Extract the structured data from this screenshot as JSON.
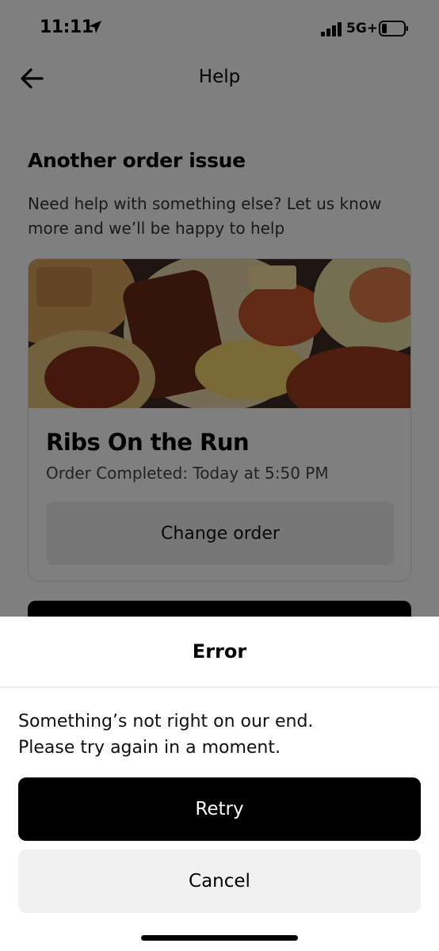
{
  "status_bar": {
    "time": "11:11",
    "network": "5G+",
    "icons": [
      "location-arrow-icon",
      "signal-bars-icon",
      "battery-icon"
    ]
  },
  "nav": {
    "title": "Help",
    "back_icon": "back-arrow-icon"
  },
  "issue": {
    "title": "Another order issue",
    "description": "Need help with something else? Let us know more and we’ll be happy to help"
  },
  "order": {
    "restaurant": "Ribs On the Run",
    "status": "Order Completed: Today at 5:50 PM",
    "change_label": "Change order"
  },
  "sheet": {
    "title": "Error",
    "message_line1": "Something’s not right on our end.",
    "message_line2": "Please try again in a moment.",
    "retry_label": "Retry",
    "cancel_label": "Cancel"
  },
  "colors": {
    "overlay": "#000000",
    "primary_button": "#000000",
    "secondary_button": "#f1f1f1",
    "sheet_background": "#ffffff"
  }
}
